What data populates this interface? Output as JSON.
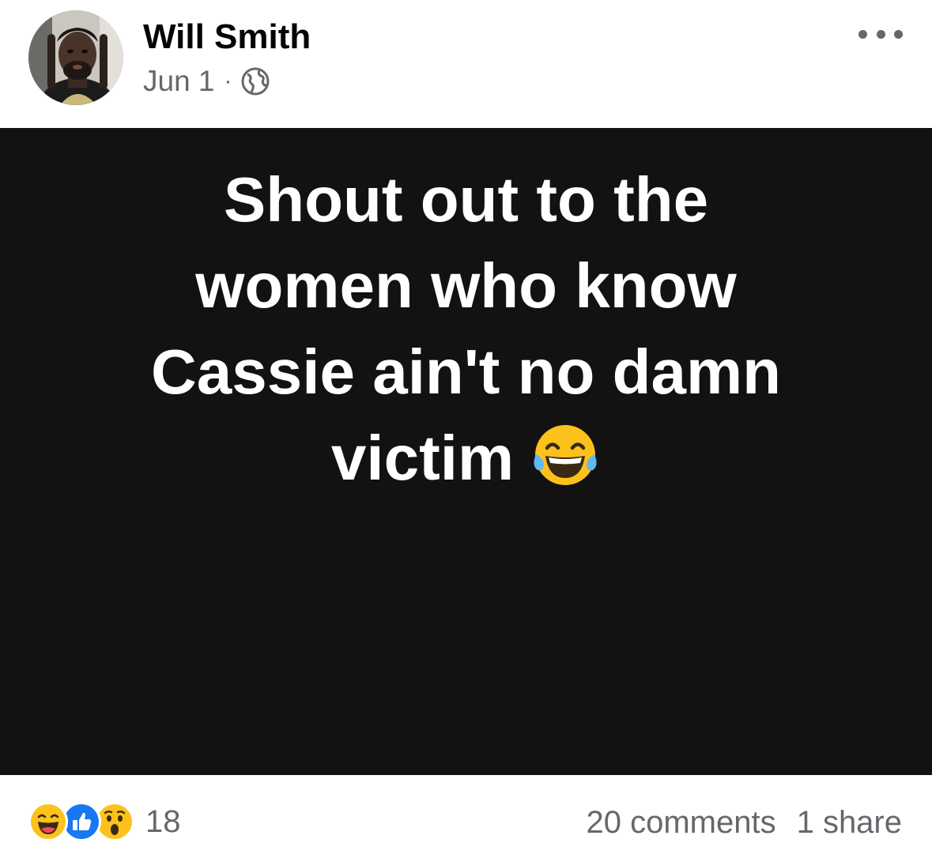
{
  "post": {
    "author": "Will Smith",
    "date": "Jun 1",
    "separator": "·",
    "privacy_icon": "globe-icon",
    "more_icon": "more-options-icon"
  },
  "media": {
    "lines": [
      "Shout out to the",
      "women who know",
      "Cassie ain't no damn",
      "victim"
    ],
    "trailing_emoji": "face-with-tears-of-joy",
    "background": "#121212"
  },
  "footer": {
    "reaction_icons": [
      "haha-icon",
      "like-icon",
      "wow-icon"
    ],
    "reaction_count": "18",
    "comments": "20 comments",
    "shares": "1 share"
  },
  "colors": {
    "like_blue": "#1877f2",
    "secondary_text": "#65676b",
    "primary_text": "#050505",
    "emoji_yellow": "#fcc21b"
  }
}
